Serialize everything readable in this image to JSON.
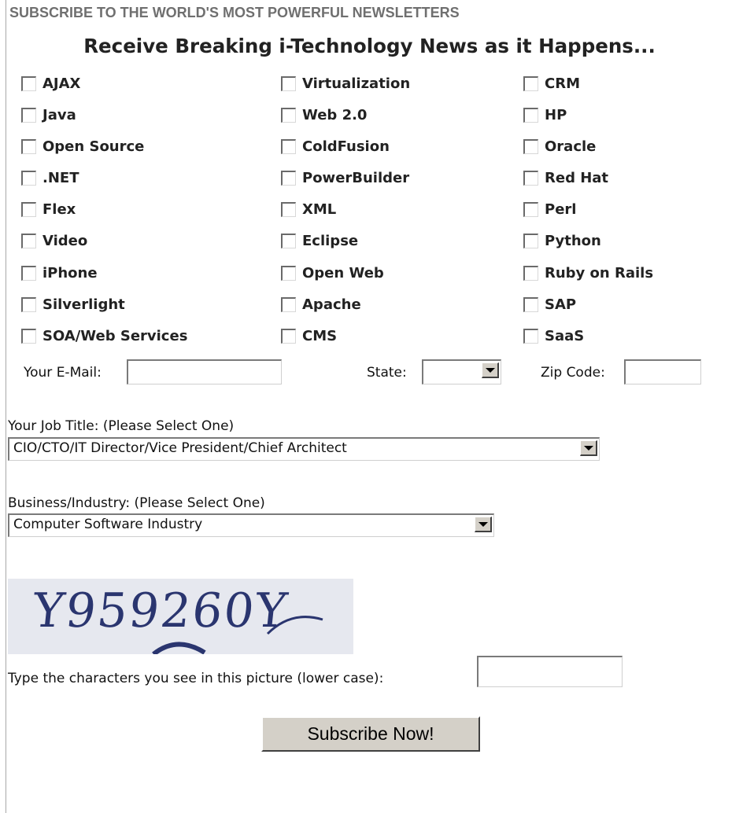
{
  "header": {
    "title": "SUBSCRIBE TO THE WORLD'S MOST POWERFUL NEWSLETTERS"
  },
  "headline": "Receive Breaking i-Technology News as it Happens...",
  "topics": [
    [
      "AJAX",
      "Virtualization",
      "CRM"
    ],
    [
      "Java",
      "Web 2.0",
      "HP"
    ],
    [
      "Open Source",
      "ColdFusion",
      "Oracle"
    ],
    [
      ".NET",
      "PowerBuilder",
      "Red Hat"
    ],
    [
      "Flex",
      "XML",
      "Perl"
    ],
    [
      "Video",
      "Eclipse",
      "Python"
    ],
    [
      "iPhone",
      "Open Web",
      "Ruby on Rails"
    ],
    [
      "Silverlight",
      "Apache",
      "SAP"
    ],
    [
      "SOA/Web Services",
      "CMS",
      "SaaS"
    ]
  ],
  "form": {
    "email_label": "Your E-Mail:",
    "email_value": "",
    "state_label": "State:",
    "state_value": "",
    "zip_label": "Zip Code:",
    "zip_value": "",
    "job_title_label": "Your Job Title: (Please Select One)",
    "job_title_value": "CIO/CTO/IT Director/Vice President/Chief Architect",
    "industry_label": "Business/Industry: (Please Select One)",
    "industry_value": "Computer Software Industry",
    "captcha_image_text": "Y959260Y",
    "captcha_prompt": "Type the characters you see in this picture (lower case):",
    "captcha_value": "",
    "submit_label": "Subscribe Now!"
  }
}
